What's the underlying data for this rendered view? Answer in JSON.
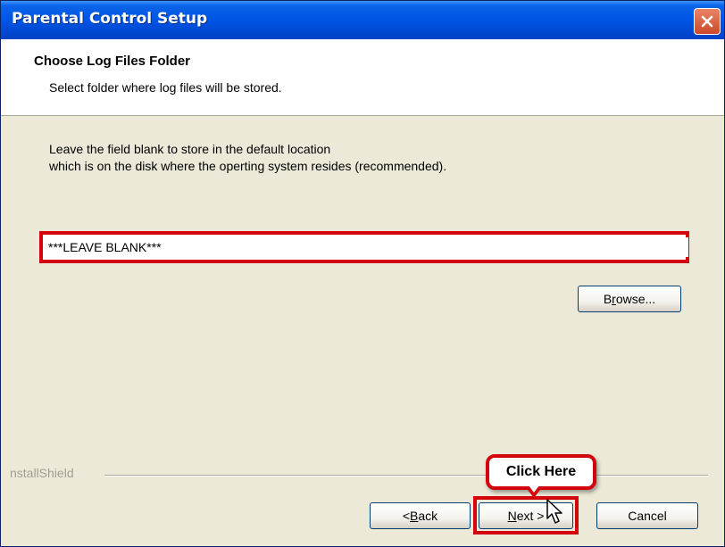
{
  "window": {
    "title": "Parental Control Setup"
  },
  "header": {
    "title": "Choose Log Files Folder",
    "subtitle": "Select folder where log files will be stored."
  },
  "body": {
    "line1": "Leave the field blank to store in the default location",
    "line2": "which is on the disk where the operting system resides (recommended)."
  },
  "folder_input": {
    "value": "***LEAVE BLANK***"
  },
  "buttons": {
    "browse": {
      "pre": "B",
      "mnemonic": "r",
      "post": "owse..."
    },
    "back": {
      "pre": "< ",
      "mnemonic": "B",
      "post": "ack"
    },
    "next": {
      "pre": "",
      "mnemonic": "N",
      "post": "ext >"
    },
    "cancel": "Cancel"
  },
  "branding": {
    "installshield": "nstallShield"
  },
  "callout": {
    "text": "Click Here"
  },
  "icons": {
    "close": "close-icon",
    "cursor": "hand-cursor-icon"
  },
  "colors": {
    "titlebar": "#0055e5",
    "highlight": "#d4040c",
    "dialog": "#ece9d8"
  }
}
